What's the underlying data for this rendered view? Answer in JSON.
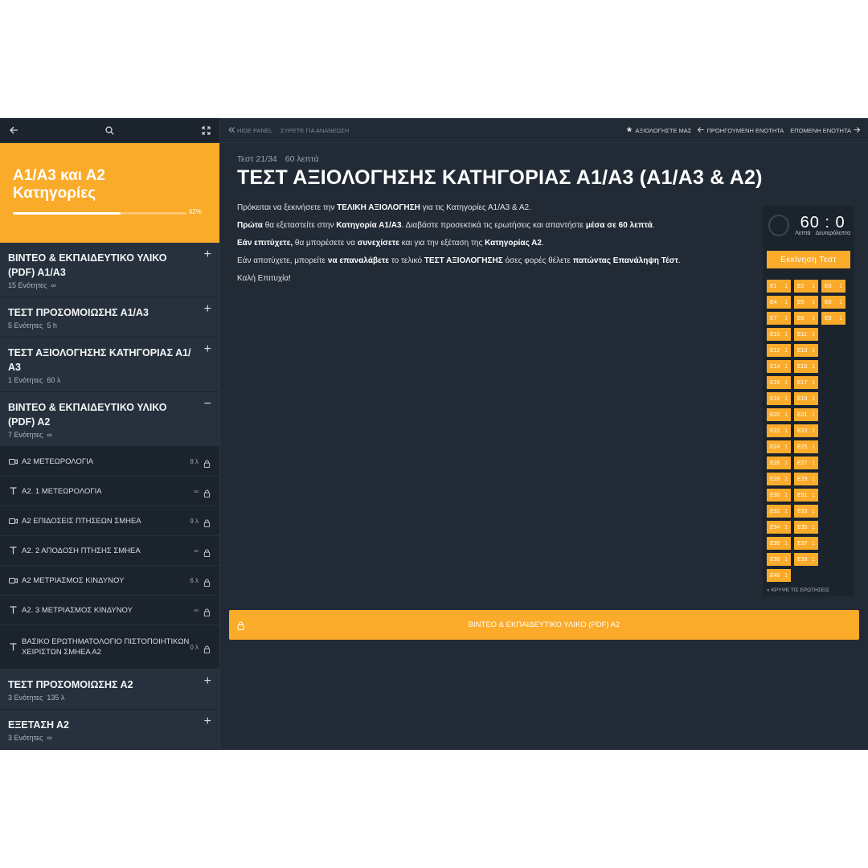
{
  "sidebar": {
    "course_title": "Α1/Α3 και Α2\nΚατηγορίες",
    "progress": {
      "percent": 62,
      "label": "62%"
    },
    "sections_top": [
      {
        "title": "ΒΙΝΤΕΟ & ΕΚΠΑΙΔΕΥΤΙΚΟ ΥΛΙΚΟ (PDF) Α1/Α3",
        "units": "15 Ενότητες",
        "duration": "∞",
        "toggle": "+"
      },
      {
        "title": "ΤΕΣΤ ΠΡΟΣΟΜΟΙΩΣΗΣ Α1/Α3",
        "units": "5 Ενότητες",
        "duration": "5 h",
        "toggle": "+"
      },
      {
        "title": "ΤΕΣΤ ΑΞΙΟΛΟΓΗΣΗΣ ΚΑΤΗΓΟΡΙΑΣ Α1/Α3",
        "units": "1 Ενότητες",
        "duration": "60 λ",
        "toggle": "+"
      },
      {
        "title": "ΒΙΝΤΕΟ & ΕΚΠΑΙΔΕΥΤΙΚΟ ΥΛΙΚΟ (PDF) Α2",
        "units": "7 Ενότητες",
        "duration": "∞",
        "toggle": "−"
      }
    ],
    "lessons": [
      {
        "icon": "video-icon",
        "title": "Α2 ΜΕΤΕΩΡΟΛΟΓΙΑ",
        "duration": "8 λ"
      },
      {
        "icon": "text-icon",
        "title": "Α2. 1 ΜΕΤΕΩΡΟΛΟΓΙΑ",
        "duration": "∞"
      },
      {
        "icon": "video-icon",
        "title": "Α2 ΕΠΙΔΟΣΕΙΣ ΠΤΗΣΕΩΝ ΣΜΗΕΑ",
        "duration": "9 λ"
      },
      {
        "icon": "text-icon",
        "title": "Α2. 2 ΑΠΟΔΟΣΗ ΠΤΗΣΗΣ ΣΜΗΕΑ",
        "duration": "∞"
      },
      {
        "icon": "video-icon",
        "title": "Α2 ΜΕΤΡΙΑΣΜΟΣ ΚΙΝΔΥΝΟΥ",
        "duration": "6 λ"
      },
      {
        "icon": "text-icon",
        "title": "Α2. 3 ΜΕΤΡΙΑΣΜΟΣ ΚΙΝΔΥΝΟΥ",
        "duration": "∞"
      },
      {
        "icon": "text-icon",
        "title": "ΒΑΣΙΚΟ ΕΡΩΤΗΜΑΤΟΛΟΓΙΟ ΠΙΣΤΟΠΟΙΗΤΙΚΩΝ ΧΕΙΡΙΣΤΩΝ ΣΜΗΕΑ Α2",
        "duration": "0 λ"
      }
    ],
    "sections_bottom": [
      {
        "title": "ΤΕΣΤ ΠΡΟΣΟΜΟΙΩΣΗΣ Α2",
        "units": "3 Ενότητες",
        "duration": "135 λ",
        "toggle": "+"
      },
      {
        "title": "ΕΞΕΤΑΣΗ Α2",
        "units": "3 Ενότητες",
        "duration": "∞",
        "toggle": "+"
      }
    ]
  },
  "topbar": {
    "hide_panel": "HIDE PANEL",
    "drag_refresh": "ΣΥΡΕΤΕ ΓΙΑ ΑΝΑΝΕΩΣΗ",
    "rate": "ΑΞΙΟΛΟΓΗΣΤΕ ΜΑΣ",
    "prev": "ΠΡΟΗΓΟΥΜΕΝΗ ΕΝΟΤΗΤΑ",
    "next": "ΕΠΟΜΕΝΗ ΕΝΟΤΗΤΑ"
  },
  "main": {
    "crumb_test": "Τεστ 21/34",
    "crumb_time": "60 λεπτά",
    "title": "ΤΕΣΤ ΑΞΙΟΛΟΓΗΣΗΣ ΚΑΤΗΓΟΡΙΑΣ Α1/Α3 (Α1/Α3 & Α2)",
    "p1a": "Πρόκειται να ξεκινήσετε την ",
    "p1b": "ΤΕΛΙΚΗ ΑΞΙΟΛΟΓΗΣΗ",
    "p1c": " για τις Κατηγορίες Α1/Α3 & Α2.",
    "p2a": "Πρώτα",
    "p2b": " θα εξεταστείτε στην ",
    "p2c": "Κατηγορία Α1/Α3",
    "p2d": ".  Διαβάστε προσεκτικά τις ερωτήσεις και απαντήστε ",
    "p2e": "μέσα σε 60 λεπτά",
    "p2f": ".",
    "p3a": "Εάν επιτύχετε,",
    "p3b": " θα μπορέσετε να ",
    "p3c": "συνεχίσετε",
    "p3d": " και για την εξέταση της ",
    "p3e": "Κατηγορίας Α2",
    "p3f": ".",
    "p4a": "Εάν αποτύχετε, μπορείτε ",
    "p4b": "να επαναλάβετε",
    "p4c": " το τελικό ",
    "p4d": "ΤΕΣΤ ΑΞΙΟΛΟΓΗΣΗΣ",
    "p4e": " όσες φορές θέλετε ",
    "p4f": "πατώντας Επανάληψη Τέστ",
    "p4g": ".",
    "p5": "Καλή Επιτυχία!"
  },
  "quiz": {
    "minutes": "60",
    "sep": ":",
    "seconds": "0",
    "min_label": "Λεπτά",
    "sec_label": "Δευτερόλεπτα",
    "start_label": "Εκκίνηση Τεστ",
    "hide_label": "ΚΡΥΨΕ ΤΙΣ ΕΡΩΤΗΣΕΙΣ",
    "chip_value": "1",
    "rows": [
      [
        "Ε1",
        "Ε2",
        "Ε3"
      ],
      [
        "Ε4",
        "Ε5",
        "Ε6"
      ],
      [
        "Ε7",
        "Ε8",
        "Ε9"
      ],
      [
        "Ε10",
        "Ε11"
      ],
      [
        "Ε12",
        "Ε13"
      ],
      [
        "Ε14",
        "Ε15"
      ],
      [
        "Ε16",
        "Ε17"
      ],
      [
        "Ε18",
        "Ε19"
      ],
      [
        "Ε20",
        "Ε21"
      ],
      [
        "Ε22",
        "Ε23"
      ],
      [
        "Ε24",
        "Ε25"
      ],
      [
        "Ε26",
        "Ε27"
      ],
      [
        "Ε28",
        "Ε29"
      ],
      [
        "Ε30",
        "Ε31"
      ],
      [
        "Ε32",
        "Ε33"
      ],
      [
        "Ε34",
        "Ε35"
      ],
      [
        "Ε36",
        "Ε37"
      ],
      [
        "Ε38",
        "Ε39"
      ],
      [
        "Ε40"
      ]
    ]
  },
  "next_section": {
    "label": "ΒΙΝΤΕΟ & ΕΚΠΑΙΔΕΥΤΙΚΟ ΥΛΙΚΟ (PDF) Α2"
  },
  "colors": {
    "accent": "#fbab2a",
    "panel": "#212a35",
    "sidebar": "#1b232d",
    "section": "#27313d"
  }
}
